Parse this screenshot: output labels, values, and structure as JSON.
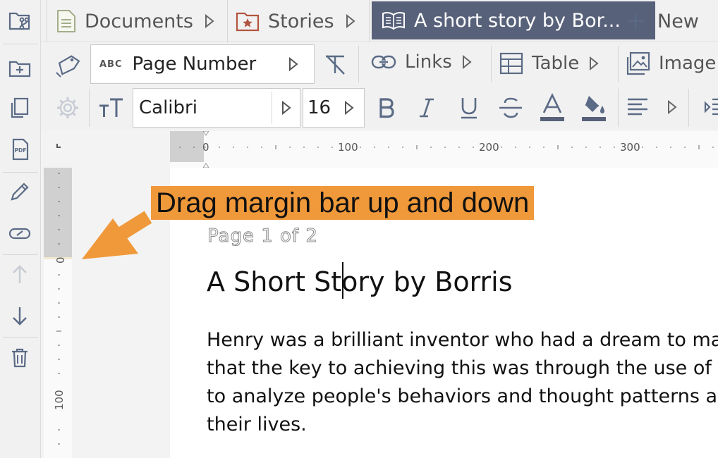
{
  "tabs": {
    "documents": "Documents",
    "stories": "Stories",
    "active": "A short story by Bor...",
    "new": "New"
  },
  "toolbar": {
    "field_type_badge": "ABC",
    "field_type": "Page Number",
    "links": "Links",
    "table": "Table",
    "image": "Image",
    "font_family": "Calibri",
    "font_size": "16"
  },
  "ruler": {
    "h_labels": [
      "0",
      "100",
      "200",
      "300"
    ],
    "v_labels": [
      "0",
      "100"
    ]
  },
  "document": {
    "page_label": "Page 1 of 2",
    "title": "A Short Story by Borris",
    "lines": [
      "Henry was a brilliant inventor who had a dream to make",
      "that the key to achieving this was through the use of AI.",
      "to analyze people's behaviors and thought patterns and",
      "their lives."
    ]
  },
  "callout": {
    "text": "Drag margin bar up and down"
  },
  "colors": {
    "accent": "#57617a",
    "callout": "#f0993a",
    "icon": "#5b6b86"
  }
}
